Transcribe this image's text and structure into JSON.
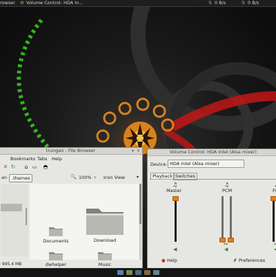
{
  "top_panel": {
    "left_task": "rowser",
    "active_task": "Volume Control: HDA In...",
    "net_down": "0 B/s",
    "net_up": "0 B/s"
  },
  "file_browser": {
    "title": "trungan - File Browser",
    "menu": [
      "Bookmarks",
      "Tabs",
      "Help"
    ],
    "toolbar_icons": [
      "close-icon",
      "reload-icon",
      "home-icon",
      "monitor-icon",
      "gamepad-icon"
    ],
    "breadcrumb": [
      "an",
      ".themes"
    ],
    "zoom": "100%",
    "view_mode": "Icon View",
    "folders": [
      {
        "name": "Documents"
      },
      {
        "name": "Download"
      },
      {
        "name": "dwhelper"
      },
      {
        "name": "Music"
      }
    ],
    "status": ": 995.4 MB"
  },
  "volume_control": {
    "title": "Volume Control: HDA Intel (Alsa mixer)",
    "device_label": "Device:",
    "device_value": "HDA Intel (Alsa mixer)",
    "tabs": [
      "Playback",
      "Switches"
    ],
    "channels": [
      {
        "label": "Master",
        "level": 1.0
      },
      {
        "label": "PCM",
        "level": 0.0
      },
      {
        "label": "Fr",
        "level": 1.0
      }
    ],
    "help_label": "Help",
    "preferences_label": "Preferences"
  },
  "colors": {
    "accent_orange": "#e8801c",
    "wallpaper_green": "#38d21e",
    "wallpaper_red": "#d91f1f"
  }
}
